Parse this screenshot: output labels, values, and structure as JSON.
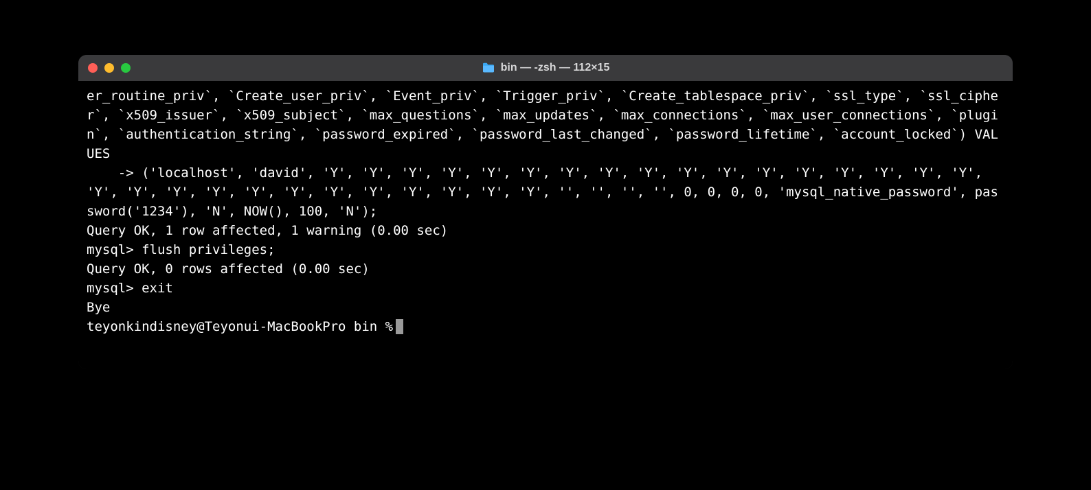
{
  "window": {
    "title": "bin — -zsh — 112×15"
  },
  "terminal": {
    "lines": {
      "l0": "er_routine_priv`, `Create_user_priv`, `Event_priv`, `Trigger_priv`, `Create_tablespace_priv`, `ssl_type`, `ssl_cipher`, `x509_issuer`, `x509_subject`, `max_questions`, `max_updates`, `max_connections`, `max_user_connections`, `plugin`, `authentication_string`, `password_expired`, `password_last_changed`, `password_lifetime`, `account_locked`) VALUES",
      "l1": "    -> ('localhost', 'david', 'Y', 'Y', 'Y', 'Y', 'Y', 'Y', 'Y', 'Y', 'Y', 'Y', 'Y', 'Y', 'Y', 'Y', 'Y', 'Y', 'Y', 'Y', 'Y', 'Y', 'Y', 'Y', 'Y', 'Y', 'Y', 'Y', 'Y', 'Y', 'Y', '', '', '', '', 0, 0, 0, 0, 'mysql_native_password', password('1234'), 'N', NOW(), 100, 'N');",
      "l2": "Query OK, 1 row affected, 1 warning (0.00 sec)",
      "l3": "",
      "l4": "mysql> flush privileges;",
      "l5": "Query OK, 0 rows affected (0.00 sec)",
      "l6": "",
      "l7": "mysql> exit",
      "l8": "Bye"
    },
    "prompt": "teyonkindisney@Teyonui-MacBookPro bin % "
  }
}
